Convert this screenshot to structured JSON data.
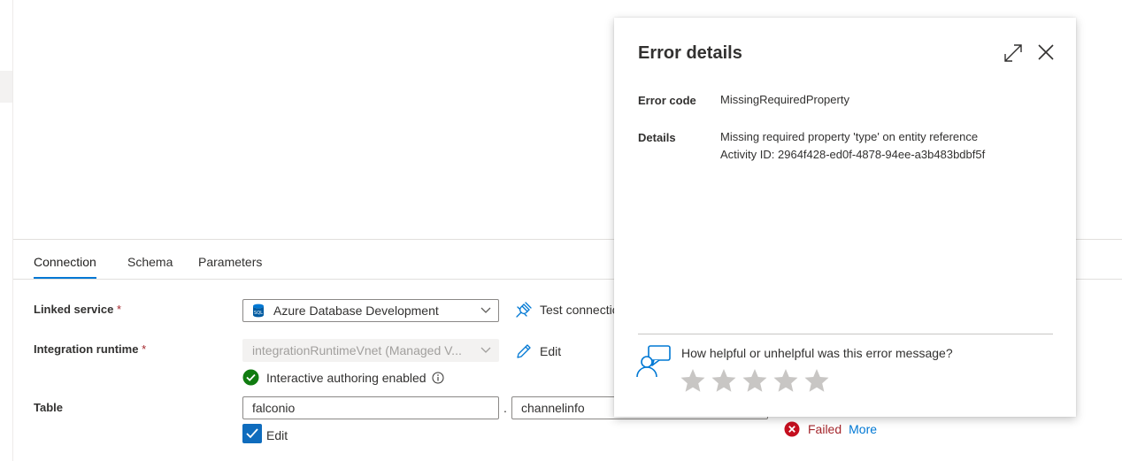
{
  "tabs": [
    {
      "label": "Connection"
    },
    {
      "label": "Schema"
    },
    {
      "label": "Parameters"
    }
  ],
  "connection": {
    "linked_service": {
      "label": "Linked service",
      "required_marker": "*",
      "value": "Azure Database Development",
      "test_label": "Test connection"
    },
    "integration_runtime": {
      "label": "Integration runtime",
      "required_marker": "*",
      "value": "integrationRuntimeVnet (Managed V...",
      "edit_label": "Edit",
      "status": "Interactive authoring enabled"
    },
    "table": {
      "label": "Table",
      "schema_value": "falconio",
      "separator": ".",
      "table_value": "channelinfo",
      "edit_checkbox_label": "Edit",
      "edit_checked": true
    },
    "test_result": {
      "status": "Failed",
      "more_label": "More"
    }
  },
  "error_panel": {
    "title": "Error details",
    "error_code_key": "Error code",
    "error_code_value": "MissingRequiredProperty",
    "details_key": "Details",
    "details_line1": "Missing required property 'type' on entity reference",
    "details_line2": "Activity ID: 2964f428-ed0f-4878-94ee-a3b483bdbf5f",
    "feedback_question": "How helpful or unhelpful was this error message?",
    "rating_max": 5,
    "rating_value": 0
  },
  "colors": {
    "accent": "#0078d4",
    "success": "#107c10",
    "error": "#a4262c",
    "star_empty": "#c8c6c4"
  }
}
